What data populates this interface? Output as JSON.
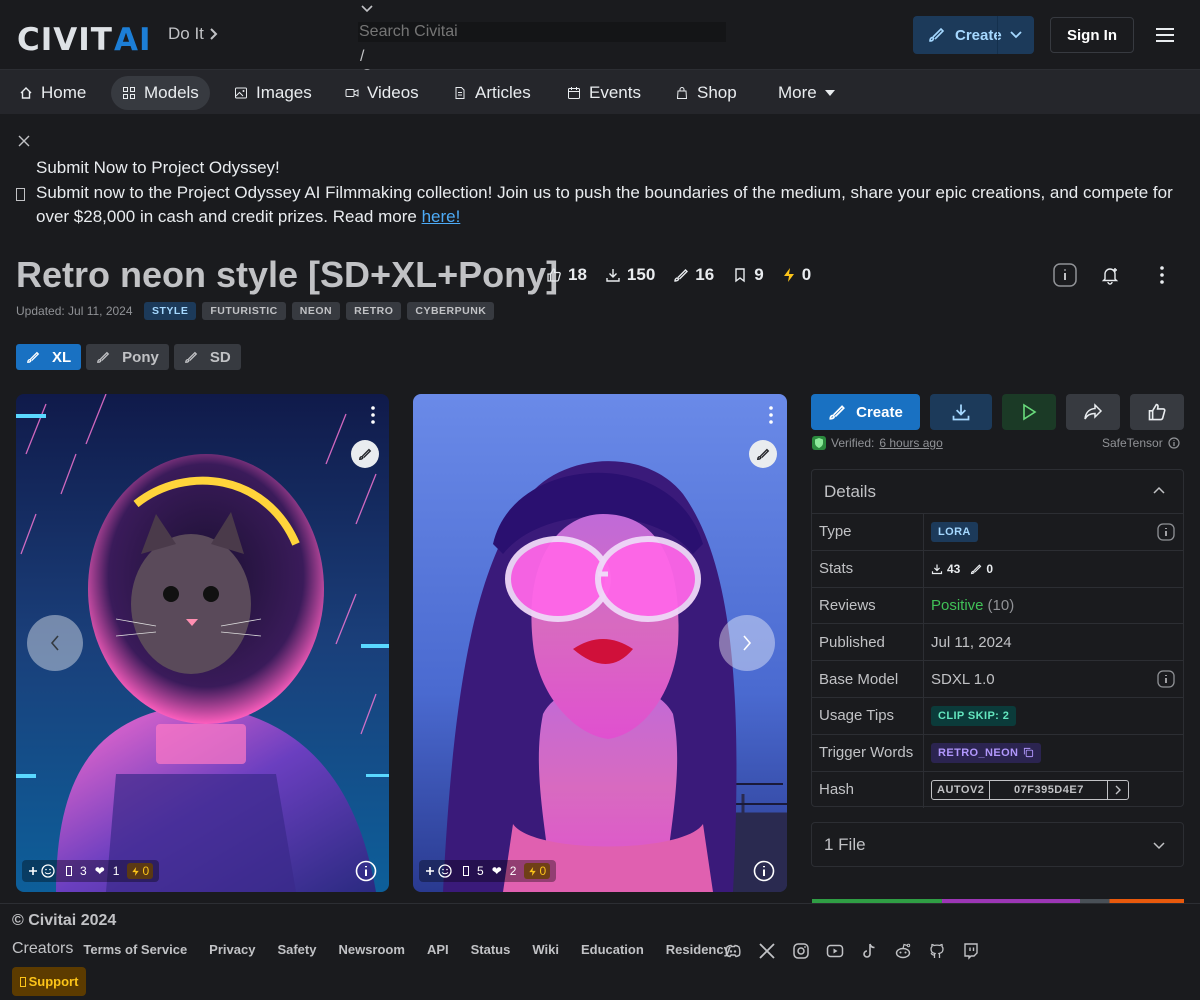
{
  "header": {
    "brand": {
      "part1": "CIVIT",
      "part2": "AI"
    },
    "tagline": "Do It",
    "search": {
      "placeholder": "Search Civitai",
      "shortcut": "/"
    },
    "create_label": "Create",
    "signin_label": "Sign In"
  },
  "nav": {
    "items": [
      {
        "label": "Home",
        "icon": "home-icon"
      },
      {
        "label": "Models",
        "icon": "grid-icon"
      },
      {
        "label": "Images",
        "icon": "photo-icon"
      },
      {
        "label": "Videos",
        "icon": "video-icon"
      },
      {
        "label": "Articles",
        "icon": "file-icon"
      },
      {
        "label": "Events",
        "icon": "calendar-icon"
      },
      {
        "label": "Shop",
        "icon": "shop-icon"
      },
      {
        "label": "More",
        "icon": "caret-down-icon"
      }
    ]
  },
  "banner": {
    "title": "Submit Now to Project Odyssey!",
    "text": "Submit now to the Project Odyssey AI Filmmaking collection! Join us to push the boundaries of the medium, share your epic creations, and compete for over $28,000 in cash and credit prizes. Read more",
    "link": "here!"
  },
  "model": {
    "title": "Retro neon style [SD+XL+Pony]",
    "stats": {
      "likes": "18",
      "downloads": "150",
      "generations": "16",
      "collected": "9",
      "buzz": "0"
    },
    "updated": "Updated: Jul 11, 2024",
    "tags": [
      "STYLE",
      "FUTURISTIC",
      "NEON",
      "RETRO",
      "CYBERPUNK"
    ],
    "versions": [
      "XL",
      "Pony",
      "SD"
    ]
  },
  "gallery": [
    {
      "comments": "3",
      "hearts": "1",
      "buzz": "0"
    },
    {
      "comments": "5",
      "hearts": "2",
      "buzz": "0"
    }
  ],
  "actions": {
    "create_label": "Create",
    "verified_label": "Verified:",
    "verified_time": "6 hours ago",
    "safetensor": "SafeTensor"
  },
  "details": {
    "title": "Details",
    "rows": {
      "type": {
        "label": "Type",
        "value": "LORA"
      },
      "stats": {
        "label": "Stats",
        "downloads": "43",
        "generations": "0"
      },
      "reviews": {
        "label": "Reviews",
        "value": "Positive",
        "count": "(10)"
      },
      "published": {
        "label": "Published",
        "value": "Jul 11, 2024"
      },
      "base_model": {
        "label": "Base Model",
        "value": "SDXL 1.0"
      },
      "usage_tips": {
        "label": "Usage Tips",
        "value": "CLIP SKIP: 2"
      },
      "trigger_words": {
        "label": "Trigger Words",
        "value": "RETRO_NEON"
      },
      "hash": {
        "label": "Hash",
        "type": "AUTOV2",
        "value": "07F395D4E7"
      }
    }
  },
  "files": {
    "label": "1 File"
  },
  "footer": {
    "copyright": "© Civitai 2024",
    "creators": "Creators",
    "links": [
      "Terms of Service",
      "Privacy",
      "Safety",
      "Newsroom",
      "API",
      "Status",
      "Wiki",
      "Education",
      "Residency"
    ],
    "support": "Support"
  },
  "colors": {
    "accent": "#1971c2",
    "buzz": "#fcc419",
    "positive": "#40c057"
  }
}
